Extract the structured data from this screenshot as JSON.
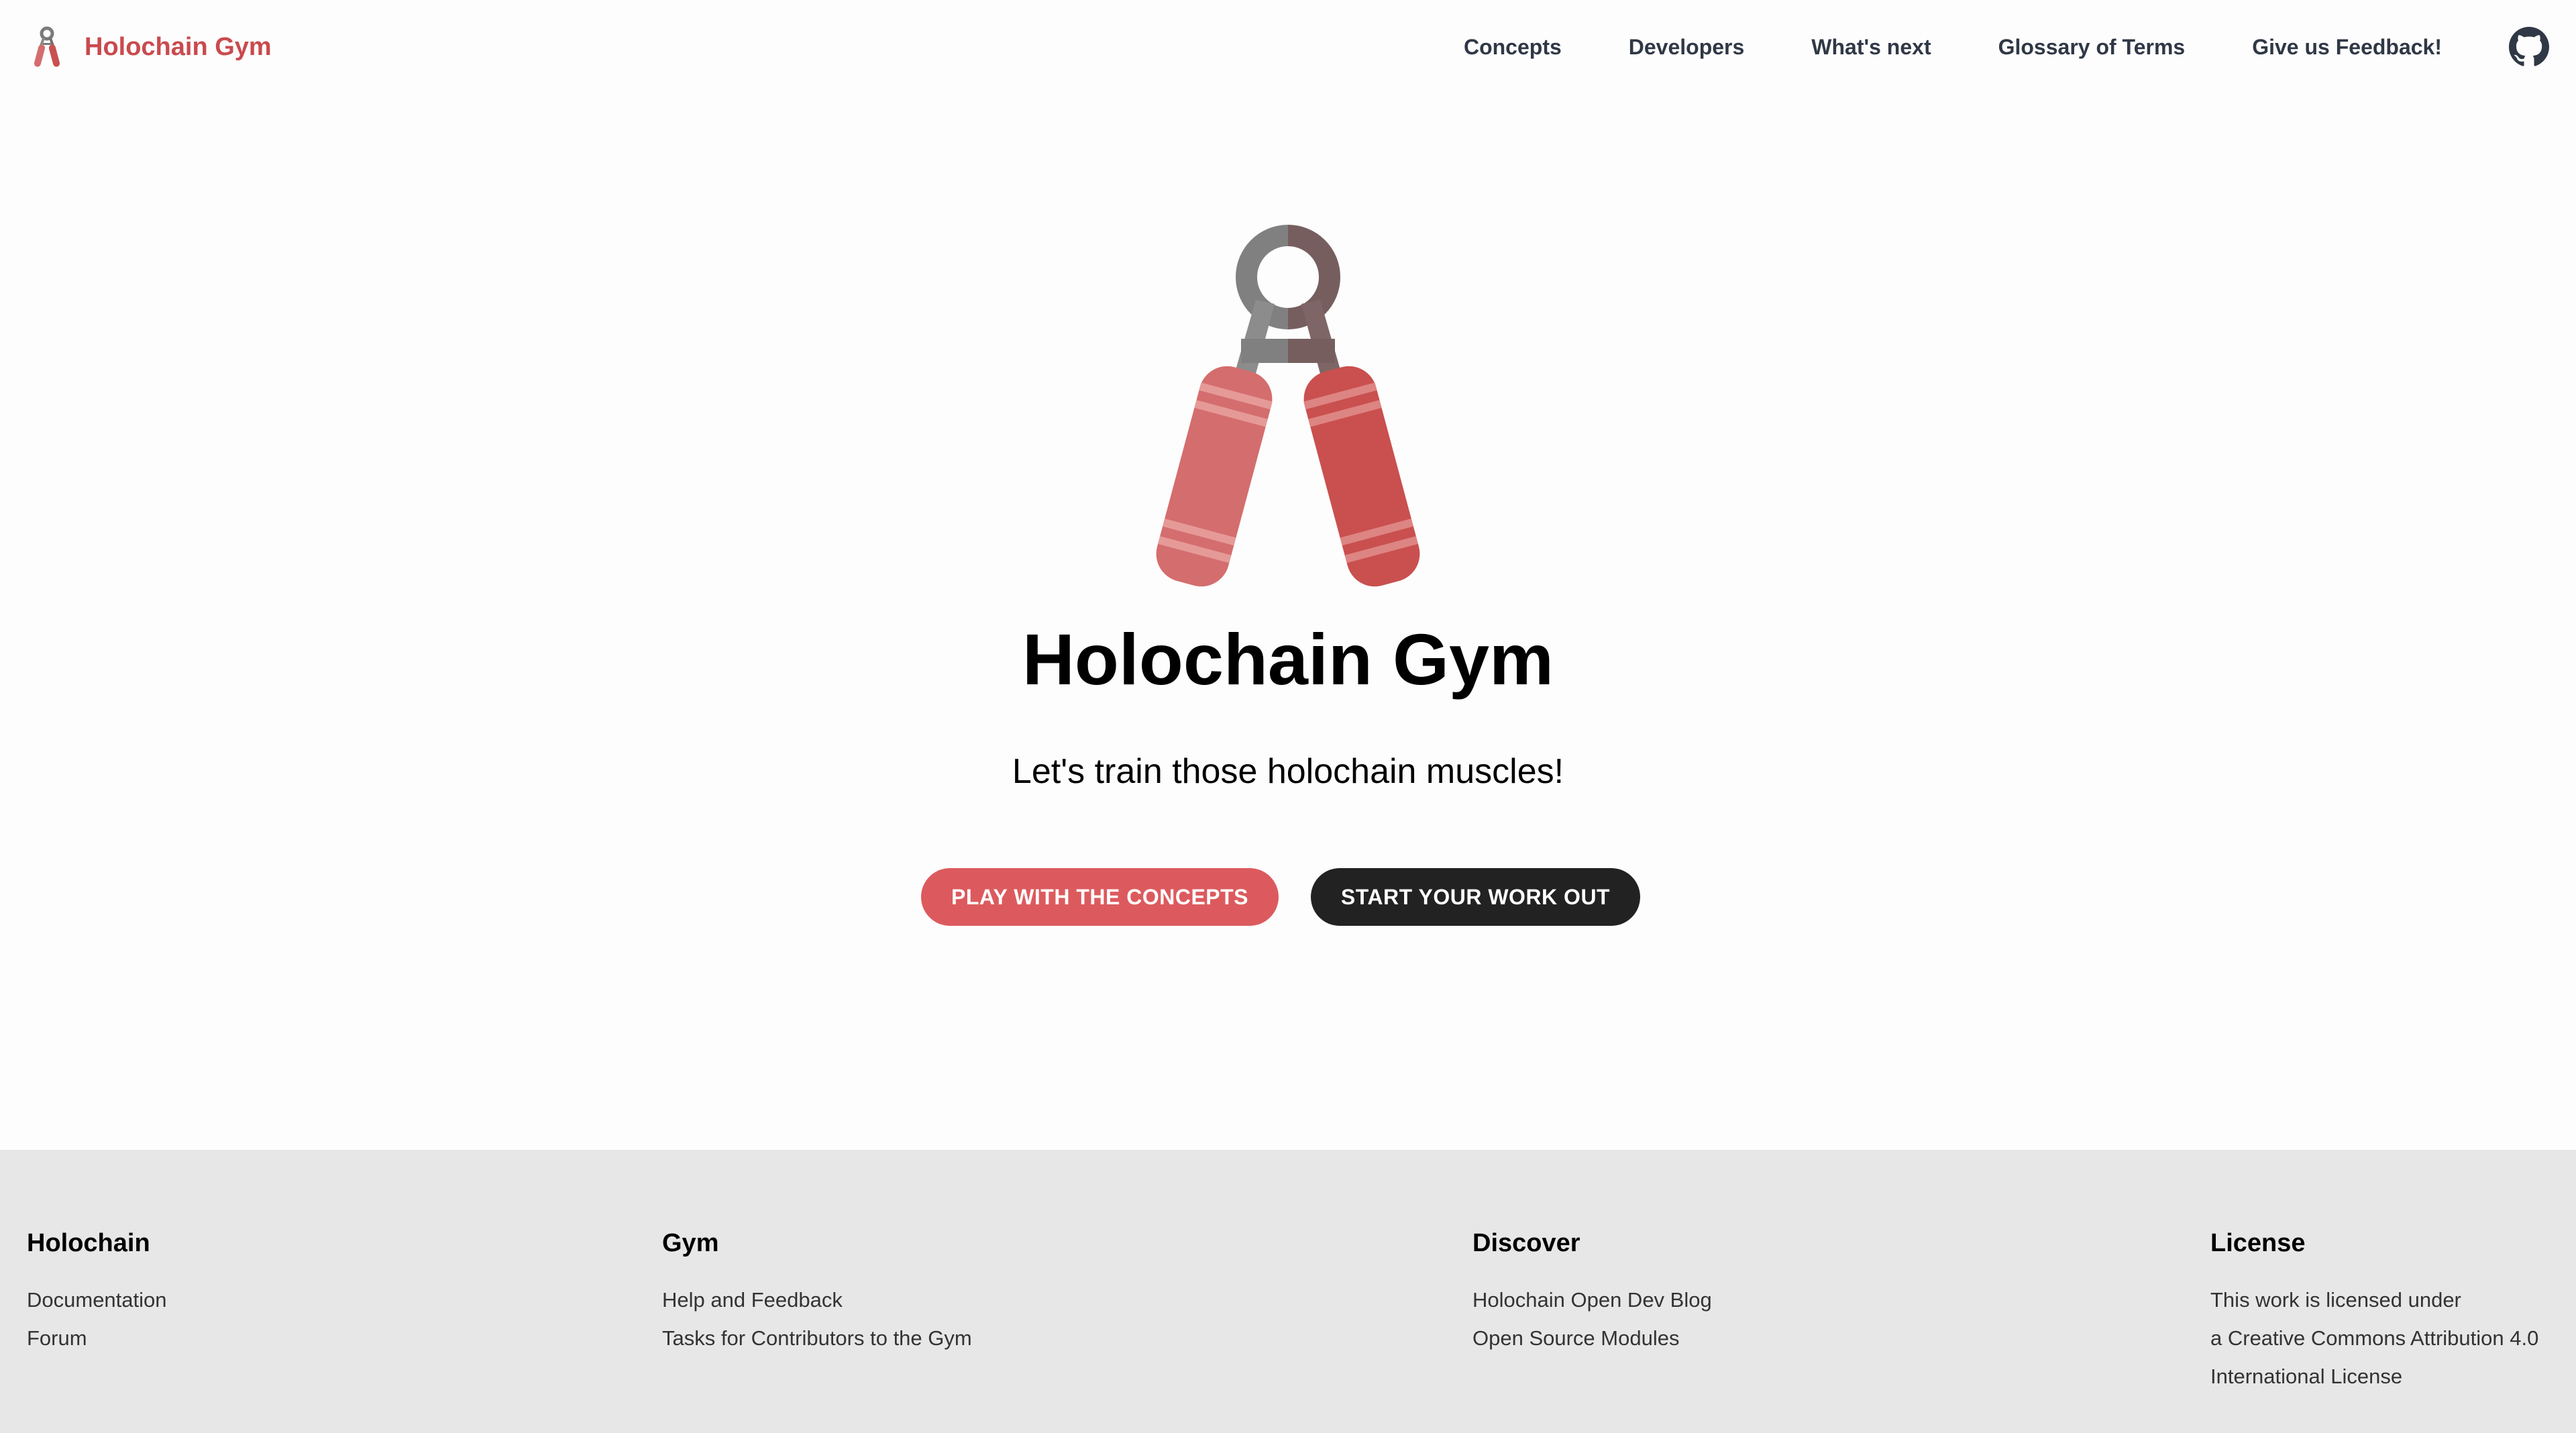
{
  "navbar": {
    "brand_title": "Holochain Gym",
    "links": [
      {
        "label": "Concepts"
      },
      {
        "label": "Developers"
      },
      {
        "label": "What's next"
      },
      {
        "label": "Glossary of Terms"
      },
      {
        "label": "Give us Feedback!"
      }
    ],
    "github_icon": "github-icon"
  },
  "hero": {
    "logo_icon": "hand-gripper-icon",
    "title": "Holochain Gym",
    "tagline": "Let's train those holochain muscles!",
    "primary_button": "PLAY WITH THE CONCEPTS",
    "secondary_button": "START YOUR WORK OUT"
  },
  "footer": {
    "columns": [
      {
        "title": "Holochain",
        "links": [
          "Documentation",
          "Forum"
        ]
      },
      {
        "title": "Gym",
        "links": [
          "Help and Feedback",
          "Tasks for Contributors to the Gym"
        ]
      },
      {
        "title": "Discover",
        "links": [
          "Holochain Open Dev Blog",
          "Open Source Modules"
        ]
      },
      {
        "title": "License",
        "lines": [
          "This work is licensed under",
          "a Creative Commons Attribution 4.0",
          "International License"
        ]
      }
    ]
  },
  "colors": {
    "brand": "#c94a4e",
    "primary_button": "#dc5a5e",
    "dark_button": "#222222",
    "footer_bg": "#e7e7e7"
  }
}
